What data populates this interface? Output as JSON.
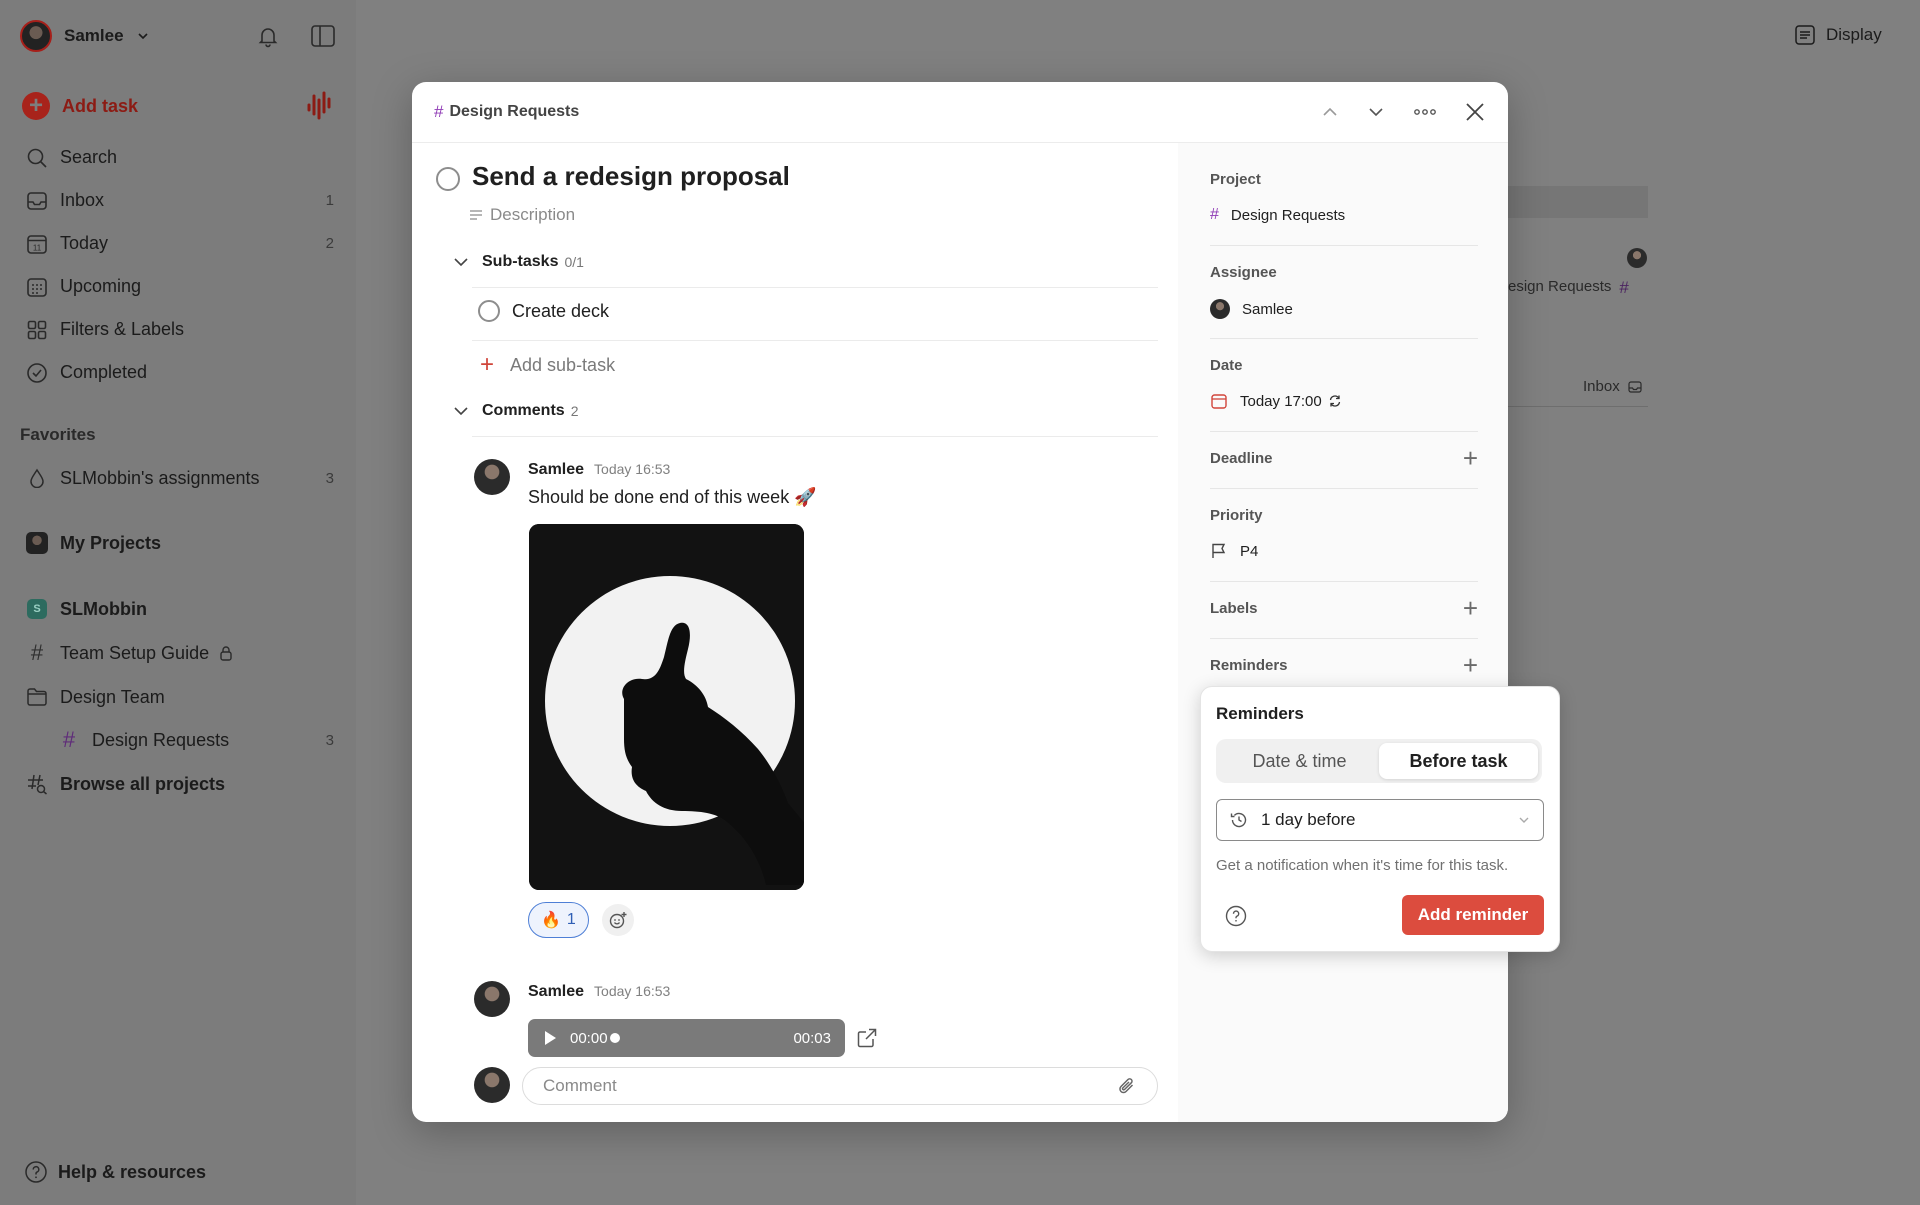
{
  "sidebar": {
    "user_name": "Samlee",
    "add_task_label": "Add task",
    "nav": [
      {
        "label": "Search",
        "count": ""
      },
      {
        "label": "Inbox",
        "count": "1"
      },
      {
        "label": "Today",
        "count": "2"
      },
      {
        "label": "Upcoming",
        "count": ""
      },
      {
        "label": "Filters & Labels",
        "count": ""
      },
      {
        "label": "Completed",
        "count": ""
      }
    ],
    "today_icon_day": "11",
    "favorites_title": "Favorites",
    "favorite_item": {
      "label": "SLMobbin's assignments",
      "count": "3"
    },
    "my_projects_label": "My Projects",
    "workspace_label": "SLMobbin",
    "workspace_badge": "S",
    "projects": [
      {
        "label": "Team Setup Guide",
        "count": ""
      },
      {
        "label": "Design Team",
        "count": ""
      },
      {
        "label": "Design Requests",
        "count": "3"
      },
      {
        "label": "Browse all projects",
        "count": ""
      }
    ],
    "help_label": "Help & resources"
  },
  "topbar": {
    "display_label": "Display"
  },
  "background_list": {
    "row1_project": "esign Requests",
    "row2_project": "Inbox"
  },
  "modal": {
    "breadcrumb": "Design Requests",
    "task_title": "Send a redesign proposal",
    "description_placeholder": "Description",
    "subtasks_label": "Sub-tasks",
    "subtasks_count": "0/1",
    "subtask_item": "Create deck",
    "add_subtask_label": "Add sub-task",
    "comments_label": "Comments",
    "comments_count": "2",
    "comments": [
      {
        "author": "Samlee",
        "time": "Today 16:53",
        "text": "Should be done end of this week 🚀",
        "reaction_emoji": "🔥",
        "reaction_count": "1"
      },
      {
        "author": "Samlee",
        "time": "Today 16:53",
        "audio_current": "00:00",
        "audio_total": "00:03"
      }
    ],
    "comment_placeholder": "Comment"
  },
  "details": {
    "project_label": "Project",
    "project_value": "Design Requests",
    "assignee_label": "Assignee",
    "assignee_value": "Samlee",
    "date_label": "Date",
    "date_value": "Today 17:00",
    "deadline_label": "Deadline",
    "priority_label": "Priority",
    "priority_value": "P4",
    "labels_label": "Labels",
    "reminders_label": "Reminders"
  },
  "reminders_popover": {
    "title": "Reminders",
    "tabs": [
      "Date & time",
      "Before task"
    ],
    "active_tab": "Before task",
    "selected_option": "1 day before",
    "hint": "Get a notification when it's time for this task.",
    "add_button": "Add reminder"
  },
  "colors": {
    "accent": "#dc4c3e",
    "project_hash": "#8f3bb5",
    "reaction_border": "#4e7fd6"
  }
}
